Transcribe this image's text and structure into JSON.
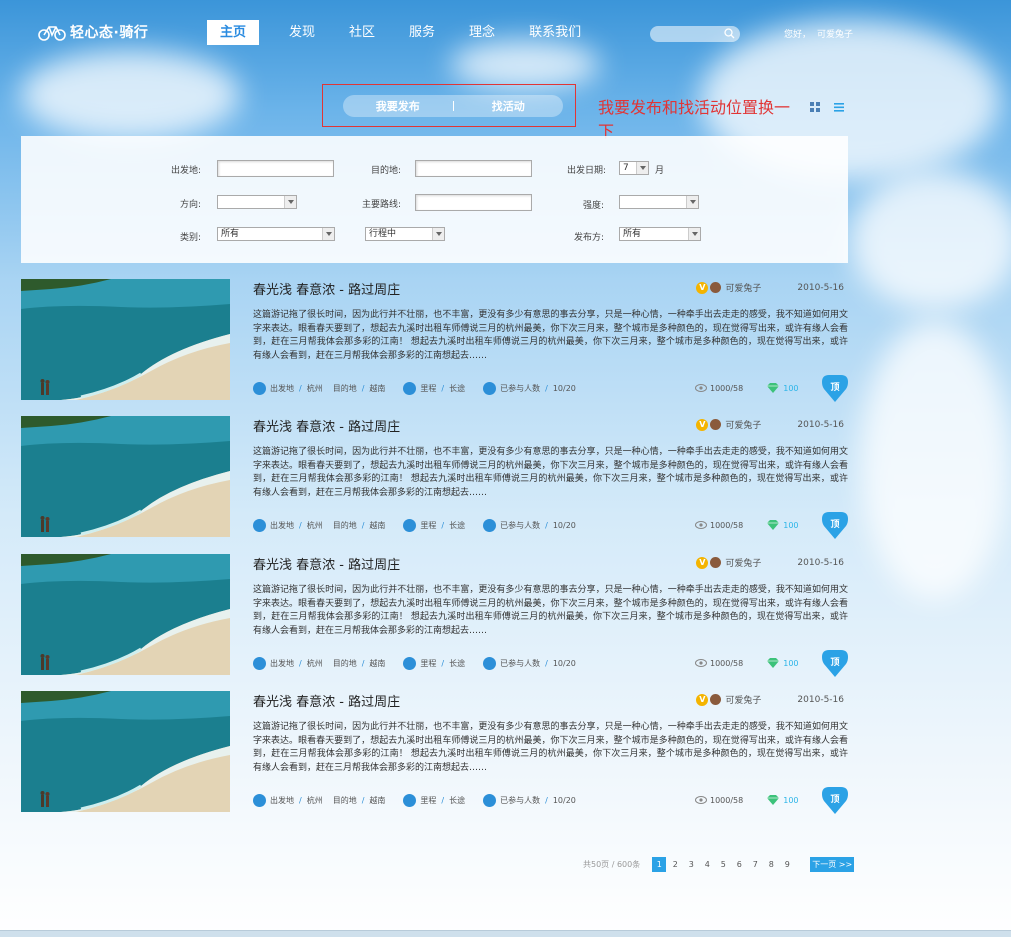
{
  "header": {
    "logo_text": "轻心态·骑行",
    "nav": [
      "主页",
      "发现",
      "社区",
      "服务",
      "理念",
      "联系我们"
    ],
    "search_placeholder": "",
    "greeting": "您好，",
    "username": "可爱兔子"
  },
  "toggle": {
    "publish": "我要发布",
    "find": "找活动"
  },
  "note": "我要发布和找活动位置换一下",
  "filters": {
    "from_label": "出发地:",
    "dest_label": "目的地:",
    "date_label": "出发日期:",
    "date_value": "7",
    "date_unit": "月",
    "direction_label": "方向:",
    "direction_value": "",
    "route_label": "主要路线:",
    "intensity_label": "强度:",
    "intensity_value": "",
    "category_label": "类别:",
    "category_value": "所有",
    "status_value": "行程中",
    "publisher_label": "发布方:",
    "publisher_value": "所有"
  },
  "posts": [
    {
      "title": "春光浅 春意浓 - 路过周庄",
      "author": "可爱兔子",
      "date": "2010-5-16",
      "body": "这篇游记拖了很长时间，因为此行并不壮丽，也不丰富，更没有多少有意思的事去分享，只是一种心情，一种牵手出去走走的感受，我不知道如何用文字来表达。眼看春天要到了，想起去九溪时出租车师傅说三月的杭州最美，你下次三月来，整个城市是多种颜色的，现在觉得写出来，或许有缘人会看到，赶在三月帮我体会那多彩的江南！   想起去九溪时出租车师傅说三月的杭州最美，你下次三月来，整个城市是多种颜色的，现在觉得写出来，或许有缘人会看到，赶在三月帮我体会那多彩的江南想起去……",
      "from_label": "出发地",
      "from": "杭州",
      "dest_label": "目的地",
      "dest": "越南",
      "route_label": "里程",
      "route": "长途",
      "join_label": "已参与人数",
      "join": "10/20",
      "views": "1000/58",
      "likes": "100",
      "top": "顶"
    },
    {
      "title": "春光浅 春意浓 - 路过周庄",
      "author": "可爱兔子",
      "date": "2010-5-16",
      "body": "这篇游记拖了很长时间，因为此行并不壮丽，也不丰富，更没有多少有意思的事去分享，只是一种心情，一种牵手出去走走的感受，我不知道如何用文字来表达。眼看春天要到了，想起去九溪时出租车师傅说三月的杭州最美，你下次三月来，整个城市是多种颜色的，现在觉得写出来，或许有缘人会看到，赶在三月帮我体会那多彩的江南！   想起去九溪时出租车师傅说三月的杭州最美，你下次三月来，整个城市是多种颜色的，现在觉得写出来，或许有缘人会看到，赶在三月帮我体会那多彩的江南想起去……",
      "from_label": "出发地",
      "from": "杭州",
      "dest_label": "目的地",
      "dest": "越南",
      "route_label": "里程",
      "route": "长途",
      "join_label": "已参与人数",
      "join": "10/20",
      "views": "1000/58",
      "likes": "100",
      "top": "顶"
    },
    {
      "title": "春光浅 春意浓 - 路过周庄",
      "author": "可爱兔子",
      "date": "2010-5-16",
      "body": "这篇游记拖了很长时间，因为此行并不壮丽，也不丰富，更没有多少有意思的事去分享，只是一种心情，一种牵手出去走走的感受，我不知道如何用文字来表达。眼看春天要到了，想起去九溪时出租车师傅说三月的杭州最美，你下次三月来，整个城市是多种颜色的，现在觉得写出来，或许有缘人会看到，赶在三月帮我体会那多彩的江南！   想起去九溪时出租车师傅说三月的杭州最美，你下次三月来，整个城市是多种颜色的，现在觉得写出来，或许有缘人会看到，赶在三月帮我体会那多彩的江南想起去……",
      "from_label": "出发地",
      "from": "杭州",
      "dest_label": "目的地",
      "dest": "越南",
      "route_label": "里程",
      "route": "长途",
      "join_label": "已参与人数",
      "join": "10/20",
      "views": "1000/58",
      "likes": "100",
      "top": "顶"
    },
    {
      "title": "春光浅 春意浓 - 路过周庄",
      "author": "可爱兔子",
      "date": "2010-5-16",
      "body": "这篇游记拖了很长时间，因为此行并不壮丽，也不丰富，更没有多少有意思的事去分享，只是一种心情，一种牵手出去走走的感受，我不知道如何用文字来表达。眼看春天要到了，想起去九溪时出租车师傅说三月的杭州最美，你下次三月来，整个城市是多种颜色的，现在觉得写出来，或许有缘人会看到，赶在三月帮我体会那多彩的江南！   想起去九溪时出租车师傅说三月的杭州最美，你下次三月来，整个城市是多种颜色的，现在觉得写出来，或许有缘人会看到，赶在三月帮我体会那多彩的江南想起去……",
      "from_label": "出发地",
      "from": "杭州",
      "dest_label": "目的地",
      "dest": "越南",
      "route_label": "里程",
      "route": "长途",
      "join_label": "已参与人数",
      "join": "10/20",
      "views": "1000/58",
      "likes": "100",
      "top": "顶"
    }
  ],
  "pager": {
    "info": "共50页 / 600条",
    "pages": [
      "1",
      "2",
      "3",
      "4",
      "5",
      "6",
      "7",
      "8",
      "9"
    ],
    "next": "下一页 >>"
  },
  "colors": {
    "accent": "#2ba2e6",
    "note_red": "#e13535"
  }
}
